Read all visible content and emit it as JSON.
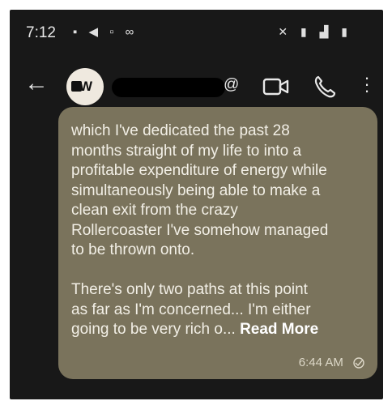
{
  "status_bar": {
    "time": "7:12",
    "notif_icons": "▪ ◀ ▫ ∞",
    "system_icons": "✕ ▮ ▟ ▮"
  },
  "app_bar": {
    "contact_initials": "W",
    "at_symbol": "@"
  },
  "message": {
    "line1": "which I've dedicated the past 28",
    "line2": "months straight of my life to into a",
    "line3": "profitable expenditure of energy while",
    "line4": "simultaneously being able to make a",
    "line5": "clean exit from the crazy",
    "line6": "Rollercoaster I've somehow managed",
    "line7": "to be thrown onto.",
    "line8": "There's only two paths at this point",
    "line9": "as far as I'm concerned... I'm either",
    "line10_prefix": "going to be very rich o... ",
    "read_more": "Read More",
    "timestamp": "6:44 AM"
  }
}
